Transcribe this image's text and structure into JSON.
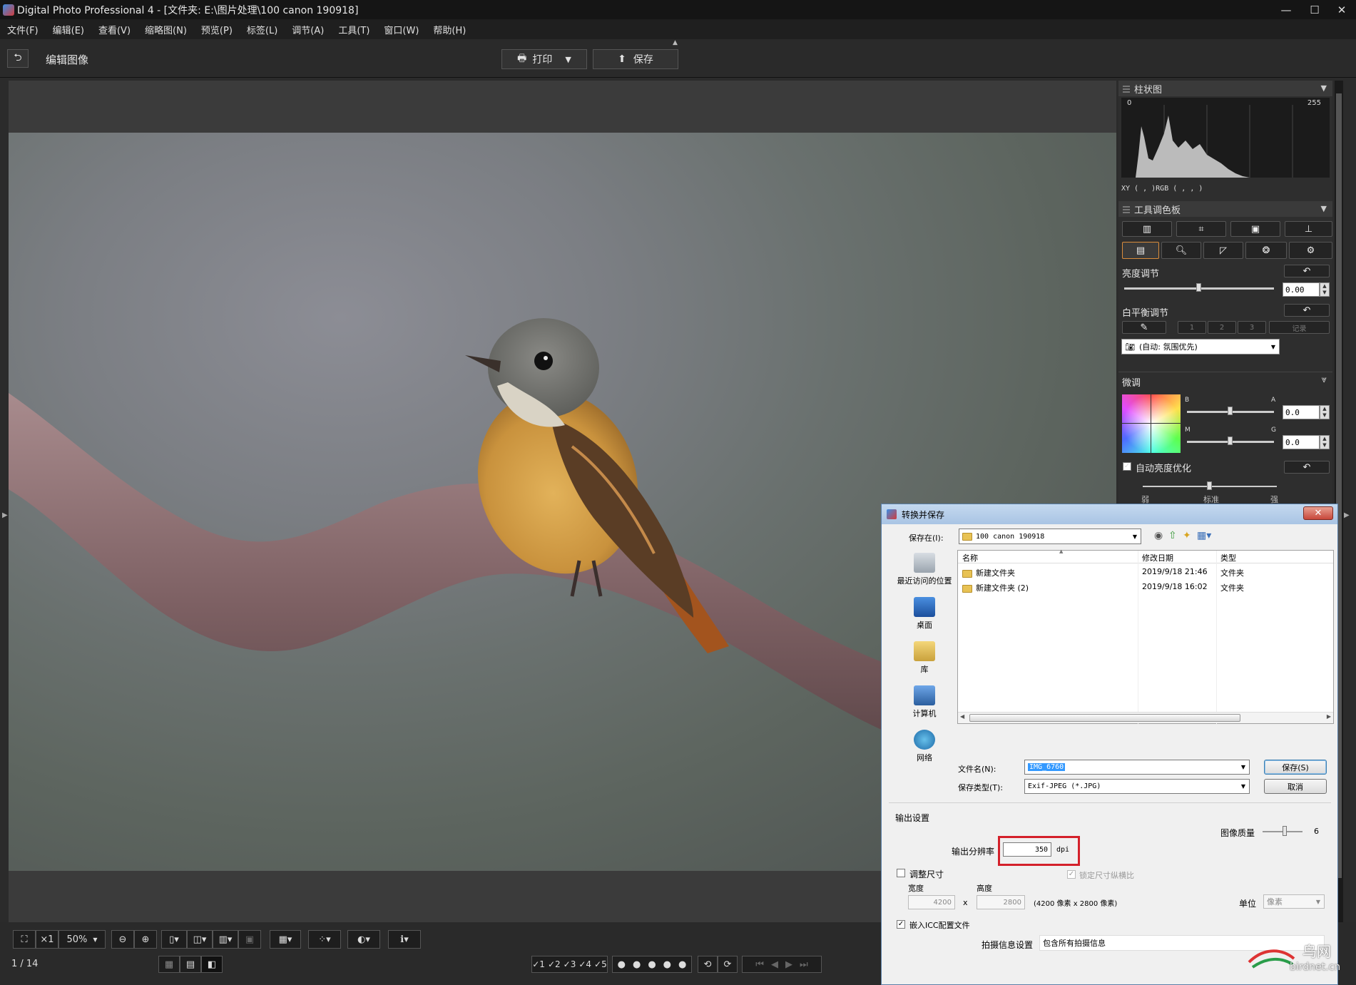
{
  "window": {
    "title": "Digital Photo Professional 4 - [文件夹: E:\\图片处理\\100 canon 190918]"
  },
  "menu": [
    "文件(F)",
    "编辑(E)",
    "查看(V)",
    "缩略图(N)",
    "预览(P)",
    "标签(L)",
    "调节(A)",
    "工具(T)",
    "窗口(W)",
    "帮助(H)"
  ],
  "toolbar": {
    "mode_label": "编辑图像",
    "print_label": "打印",
    "save_label": "保存"
  },
  "histogram": {
    "title": "柱状图",
    "min": "0",
    "max": "255",
    "readout": "XY (    ,    )RGB (    ,    ,    )"
  },
  "palette": {
    "title": "工具调色板",
    "brightness": {
      "label": "亮度调节",
      "value": "0.00"
    },
    "wb": {
      "label": "白平衡调节",
      "presets": [
        "1",
        "2",
        "3"
      ],
      "record": "记录",
      "mode": "(自动: 氛围优先)"
    },
    "fine": {
      "label": "微调",
      "b": "B",
      "a": "A",
      "m": "M",
      "g": "G",
      "ba_value": "0.0",
      "mg_value": "0.0"
    },
    "alo": {
      "label": "自动亮度优化",
      "low": "弱",
      "std": "标准",
      "high": "强",
      "checked": "✓"
    }
  },
  "bottom": {
    "zoom": "50%",
    "x1": "×1",
    "page": "1 / 14",
    "ratings": [
      "✓1",
      "✓2",
      "✓3",
      "✓4",
      "✓5"
    ]
  },
  "dialog": {
    "title": "转换并保存",
    "save_in_label": "保存在(I):",
    "folder": "100 canon 190918",
    "nav": [
      "最近访问的位置",
      "桌面",
      "库",
      "计算机",
      "网络"
    ],
    "columns": {
      "name": "名称",
      "date": "修改日期",
      "type": "类型"
    },
    "files": [
      {
        "name": "新建文件夹",
        "date": "2019/9/18 21:46",
        "type": "文件夹"
      },
      {
        "name": "新建文件夹 (2)",
        "date": "2019/9/18 16:02",
        "type": "文件夹"
      }
    ],
    "filename_label": "文件名(N):",
    "filename": "IMG_6760",
    "filetype_label": "保存类型(T):",
    "filetype": "Exif-JPEG (*.JPG)",
    "save_btn": "保存(S)",
    "cancel_btn": "取消",
    "output_label": "输出设置",
    "quality_label": "图像质量",
    "quality_value": "6",
    "resolution_label": "输出分辨率",
    "resolution_value": "350",
    "dpi": "dpi",
    "resize_label": "调整尺寸",
    "lock_label": "锁定尺寸纵横比",
    "width_label": "宽度",
    "height_label": "高度",
    "width": "4200",
    "height": "2800",
    "x": "x",
    "size_info": "(4200 像素 x 2800 像素)",
    "unit_label": "单位",
    "unit": "像素",
    "icc_label": "嵌入ICC配置文件",
    "shoot_label": "拍摄信息设置",
    "shoot_value": "包含所有拍摄信息"
  },
  "watermark": {
    "cn": "鸟网",
    "en": "birdnet.cn"
  }
}
